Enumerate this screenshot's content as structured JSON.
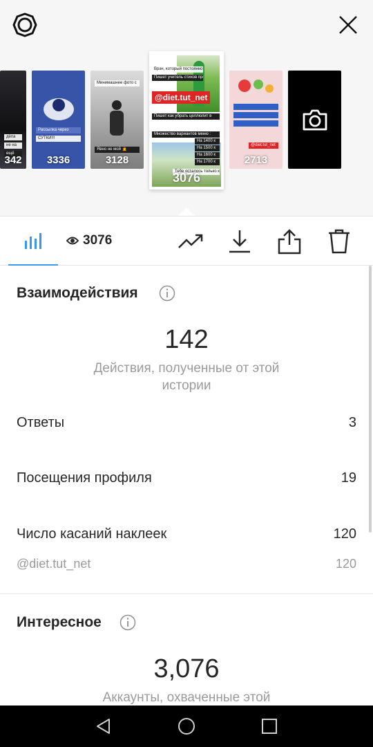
{
  "stories": [
    {
      "views": "342",
      "lines": [
        "дёпа",
        "не на",
        "ещё"
      ]
    },
    {
      "views": "3336",
      "lines": [
        "Рассылка через",
        "СУТКИ!!!"
      ]
    },
    {
      "views": "3128",
      "lines": [
        "Минимашнее фото с",
        "Явно не мой 🙍"
      ]
    },
    {
      "views": "3076",
      "brand": "@diet.tut_net",
      "lines": [
        "Врач, который постоянно рвёт",
        "Пишет учитель стихов про еду",
        "Пишет как убрать целлюлит в",
        "Множество вариантов меню :",
        "На 1400 к",
        "На 1500 к",
        "На 1600 к",
        "На 1700 к",
        "Тебе осталось только купить"
      ]
    },
    {
      "views": "2713",
      "brand": "@diet.tut_net"
    }
  ],
  "toolbar": {
    "views": "3076"
  },
  "interactions": {
    "title": "Взаимодействия",
    "total": "142",
    "total_caption": "Действия, полученные от этой истории",
    "rows": [
      {
        "label": "Ответы",
        "value": "3"
      },
      {
        "label": "Посещения профиля",
        "value": "19"
      },
      {
        "label": "Число касаний наклеек",
        "value": "120"
      }
    ],
    "sticker": {
      "label": "@diet.tut_net",
      "value": "120"
    }
  },
  "discovery": {
    "title": "Интересное",
    "total": "3,076",
    "total_caption": "Аккаунты, охваченные этой"
  },
  "colors": {
    "accent": "#3897f0",
    "brand_red": "#e02424"
  },
  "icons": [
    "gear-icon",
    "close-icon",
    "camera-icon",
    "bar-chart-icon",
    "eye-icon",
    "trending-icon",
    "download-icon",
    "share-icon",
    "trash-icon",
    "info-icon",
    "back-icon",
    "home-icon",
    "recents-icon"
  ]
}
